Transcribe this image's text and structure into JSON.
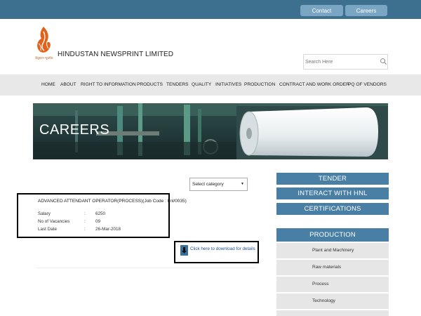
{
  "topbar": {
    "contact_label": "Contact",
    "careers_label": "Careers"
  },
  "header": {
    "logo_caption": "हिंदुस्तान न्यूज़प्रिंट",
    "brand": "HINDUSTAN NEWSPRINT LIMITED",
    "search_placeholder": "Search Here"
  },
  "nav": {
    "items": [
      "HOME",
      "ABOUT",
      "RIGHT TO INFORMATION",
      "PRODUCTS",
      "TENDERS",
      "QUALITY",
      "INITIATIVES",
      "PRODUCTION",
      "CONTRACT AND WORK ORDER",
      "PQ OF VENDORS"
    ]
  },
  "banner": {
    "title": "CAREERS"
  },
  "filter": {
    "selected": "Select category"
  },
  "job": {
    "title": "ADVANCED ATTENDANT OPERATOR(PROCESS)(Job Code : hnl/0035)",
    "rows": [
      {
        "label": "Salary",
        "sep": ":",
        "value": "6250"
      },
      {
        "label": "No of Vacancies",
        "sep": ":",
        "value": "09"
      },
      {
        "label": "Last Date",
        "sep": ":",
        "value": "26-Mar-2018"
      }
    ]
  },
  "download": {
    "label": "Click here to download for details"
  },
  "sidebar": {
    "links": [
      "TENDER",
      "INTERACT WITH HNL",
      "CERTIFICATIONS"
    ],
    "production": {
      "title": "PRODUCTION",
      "items": [
        "Plant and Machinery",
        "Raw materials",
        "Process",
        "Technology"
      ]
    }
  },
  "colors": {
    "topbar": "#3d6f8e",
    "sidebar_blue": "#4a7fa5",
    "nav_bg": "#e8e8e8",
    "logo_orange": "#e2611b"
  }
}
